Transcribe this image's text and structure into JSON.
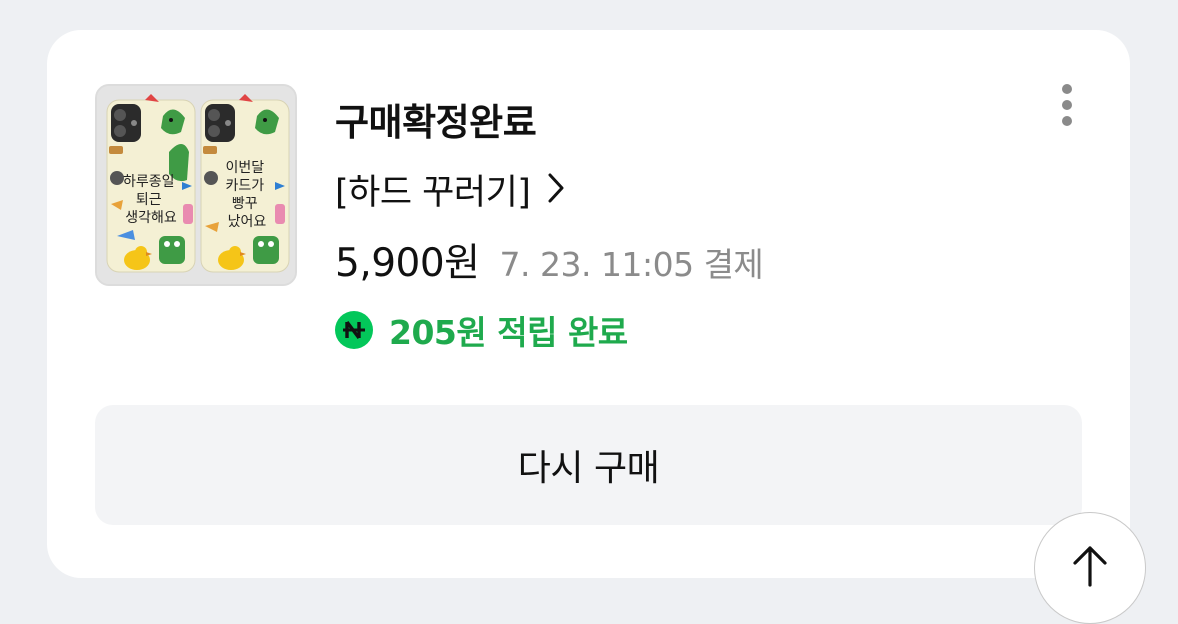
{
  "order": {
    "status": "구매확정완료",
    "product_name": "[하드 꾸러기]",
    "price": "5,900원",
    "paid_at": "7. 23. 11:05 결제",
    "points": "205원 적립 완료",
    "rebuy_label": "다시 구매"
  },
  "thumbnail": {
    "case_left_text": [
      "하루종일",
      "퇴근",
      "생각해요"
    ],
    "case_right_text": [
      "이번달",
      "카드가",
      "빵꾸",
      "났어요"
    ]
  },
  "icons": {
    "more": "more-vertical-icon",
    "chevron": "chevron-right-icon",
    "npay": "naver-pay-points-icon",
    "scroll_top": "arrow-up-icon"
  },
  "colors": {
    "points_green": "#1faa4d",
    "npay_badge": "#03c75a",
    "muted_text": "#8b8b8b"
  }
}
